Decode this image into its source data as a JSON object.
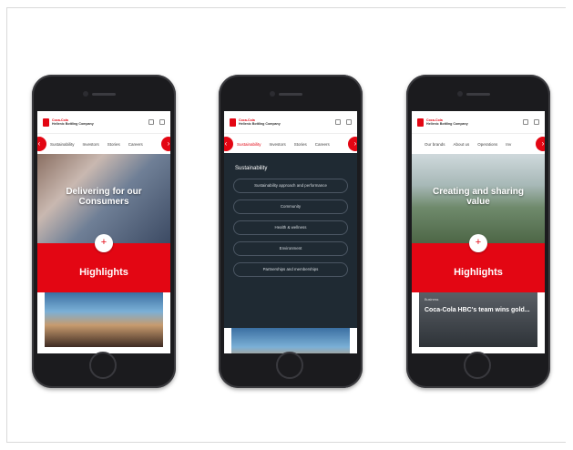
{
  "brand": {
    "name_top": "Coca-Cola",
    "name_bottom": "Hellenic Bottling Company",
    "accent": "#e30613",
    "dark_menu": "#1f2a33"
  },
  "phone1": {
    "nav": [
      "Sustainability",
      "Investors",
      "Stories",
      "Careers"
    ],
    "hero": "Delivering for our Consumers",
    "highlights": "Highlights"
  },
  "phone2": {
    "nav": [
      "Sustainability",
      "Investors",
      "Stories",
      "Careers"
    ],
    "menu_title": "Sustainability",
    "menu_items": [
      "Sustainability approach and performance",
      "Community",
      "Health & wellness",
      "Environment",
      "Partnerships and memberships"
    ]
  },
  "phone3": {
    "nav": [
      "Our brands",
      "About us",
      "Operations",
      "Inv"
    ],
    "hero": "Creating and sharing value",
    "highlights": "Highlights",
    "news_category": "Business",
    "news_title": "Coca-Cola HBC's team wins gold..."
  },
  "icons": {
    "arrow_left": "‹",
    "arrow_right": "›",
    "expand": "+"
  }
}
